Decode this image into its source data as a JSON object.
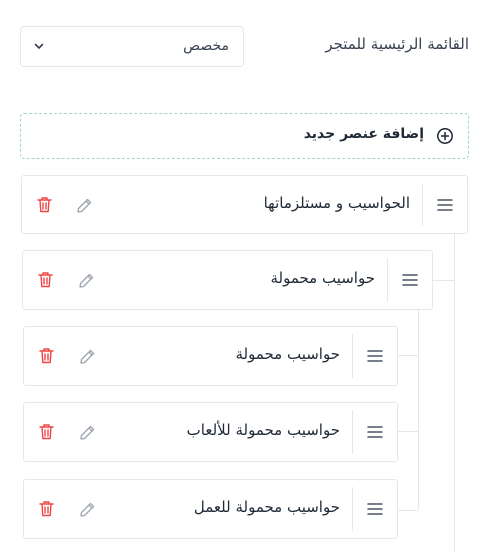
{
  "menu": {
    "label": "القائمة الرئيسية للمتجر",
    "selected": "مخصص"
  },
  "add_item": {
    "label": "إضافة عنصر جديد"
  },
  "tree": [
    {
      "label": "الحواسيب و مستلزماتها",
      "level": 0
    },
    {
      "label": "حواسيب محمولة",
      "level": 1
    },
    {
      "label": "حواسيب محمولة",
      "level": 2
    },
    {
      "label": "حواسيب محمولة للألعاب",
      "level": 2
    },
    {
      "label": "حواسيب محمولة للعمل",
      "level": 2
    }
  ],
  "colors": {
    "delete_icon": "#ef4444",
    "edit_icon": "#9ca3af",
    "add_border": "#9fd8c8",
    "border": "#e5e7eb"
  },
  "icons": {
    "select": "chevron-down-icon",
    "add": "plus-circle-icon",
    "handle": "drag-handle-icon",
    "edit": "pencil-icon",
    "delete": "trash-icon"
  }
}
